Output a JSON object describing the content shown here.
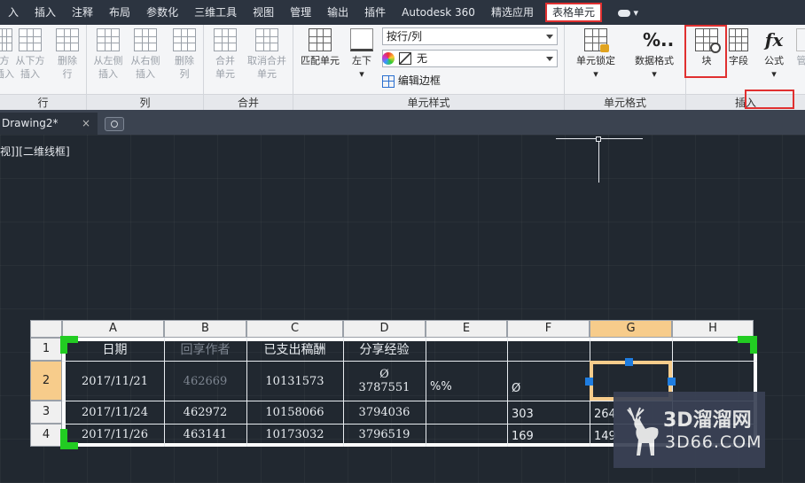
{
  "menubar": {
    "items": [
      "入",
      "插入",
      "注释",
      "布局",
      "参数化",
      "三维工具",
      "视图",
      "管理",
      "输出",
      "插件",
      "Autodesk 360",
      "精选应用"
    ],
    "active": "表格单元"
  },
  "ribbon": {
    "panels": {
      "row": {
        "title": "行",
        "buttons": [
          {
            "line1": "方",
            "line2": "插入"
          },
          {
            "line1": "从下方",
            "line2": "插入"
          },
          {
            "line1": "删除",
            "line2": "行"
          }
        ]
      },
      "col": {
        "title": "列",
        "buttons": [
          {
            "line1": "从左侧",
            "line2": "插入"
          },
          {
            "line1": "从右侧",
            "line2": "插入"
          },
          {
            "line1": "删除",
            "line2": "列"
          }
        ]
      },
      "merge": {
        "title": "合并",
        "buttons": [
          {
            "line1": "合并",
            "line2": "单元"
          },
          {
            "line1": "取消合并",
            "line2": "单元"
          }
        ]
      },
      "cell_style": {
        "title": "单元样式",
        "match": "匹配单元",
        "align": "左下",
        "style_select": "按行/列",
        "fill_select": "无",
        "edit_border": "编辑边框"
      },
      "cell_format": {
        "title": "单元格式",
        "lock": "单元锁定",
        "data_format": "数据格式",
        "format_symbol": "%.."
      },
      "insert": {
        "title": "插入",
        "block": "块",
        "field": "字段",
        "formula": "公式",
        "formula_symbol": "fx",
        "manage": "管"
      }
    }
  },
  "tabs": {
    "doc": "Drawing2*",
    "close": "×"
  },
  "viewport": {
    "label": "视]][二维线框]"
  },
  "table": {
    "columns": [
      "A",
      "B",
      "C",
      "D",
      "E",
      "F",
      "G",
      "H"
    ],
    "selected_column": "G",
    "rows": [
      "1",
      "2",
      "3",
      "4"
    ],
    "selected_row": "2",
    "header": [
      "日期",
      "回享作者",
      "已支出稿酬",
      "分享经验"
    ],
    "r2": {
      "a": "2017/11/21",
      "b": "462669",
      "c": "10131573",
      "d1": "Ø",
      "d2": "3787551",
      "e": "%%",
      "f": "Ø"
    },
    "r3": {
      "a": "2017/11/24",
      "b": "462972",
      "c": "10158066",
      "d": "3794036",
      "f": "303",
      "g": "264"
    },
    "r4": {
      "a": "2017/11/26",
      "b": "463141",
      "c": "10173032",
      "d": "3796519",
      "f": "169",
      "g": "149"
    }
  },
  "watermark": {
    "title": "3D溜溜网",
    "site": "3D66.COM"
  },
  "colors": {
    "accent_red": "#e03030",
    "selection_orange": "#f7cc8b",
    "grip_blue": "#1f7de0",
    "corner_green": "#22cc22"
  }
}
